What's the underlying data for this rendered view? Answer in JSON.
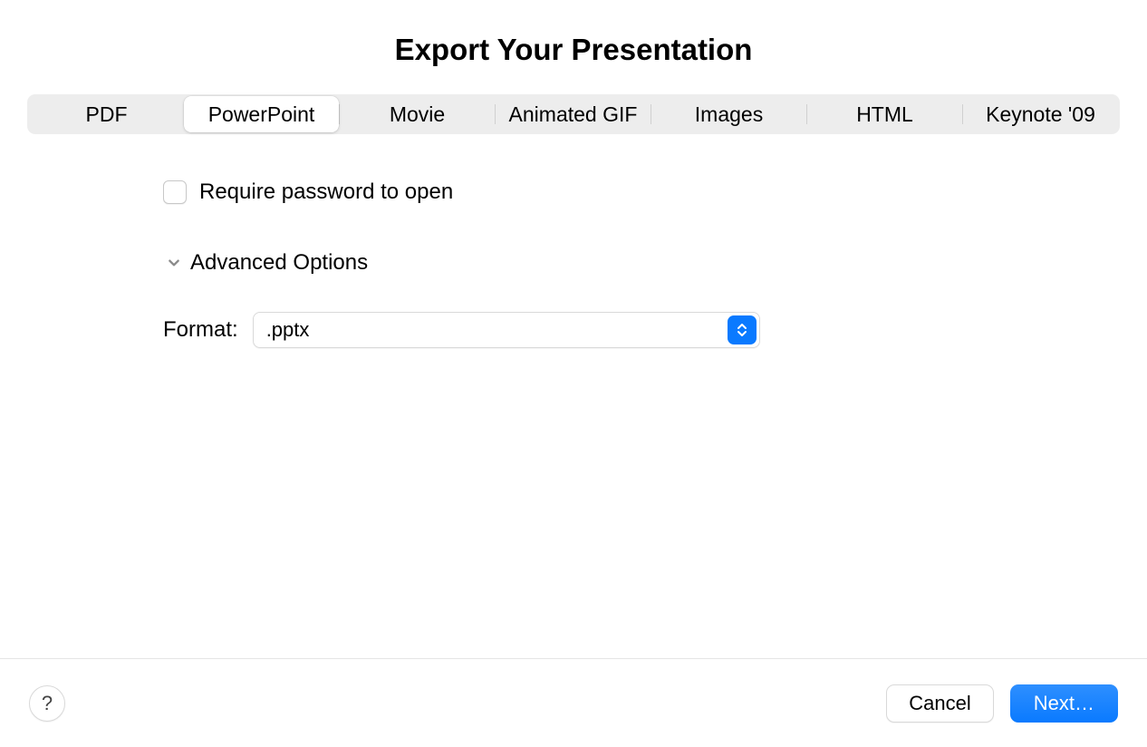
{
  "dialog": {
    "title": "Export Your Presentation"
  },
  "tabs": [
    {
      "label": "PDF"
    },
    {
      "label": "PowerPoint"
    },
    {
      "label": "Movie"
    },
    {
      "label": "Animated GIF"
    },
    {
      "label": "Images"
    },
    {
      "label": "HTML"
    },
    {
      "label": "Keynote '09"
    }
  ],
  "options": {
    "require_password_label": "Require password to open",
    "advanced_options_label": "Advanced Options",
    "format_label": "Format:",
    "format_value": ".pptx"
  },
  "footer": {
    "help_label": "?",
    "cancel_label": "Cancel",
    "next_label": "Next…"
  }
}
